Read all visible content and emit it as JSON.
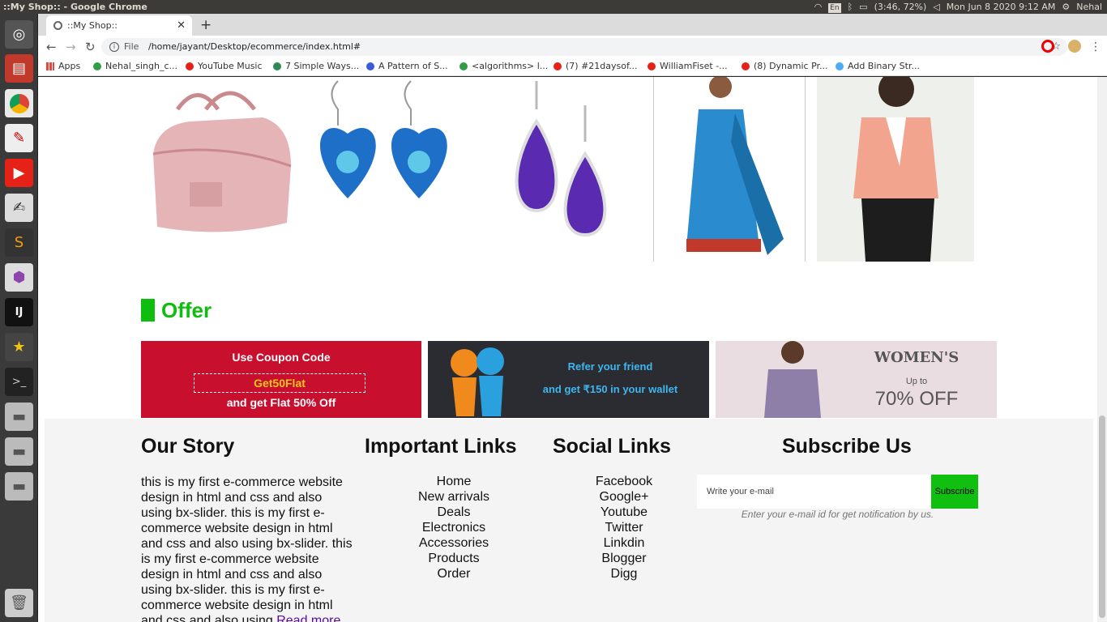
{
  "system": {
    "window_title": "::My Shop:: - Google Chrome",
    "lang": "En",
    "battery": "(3:46, 72%)",
    "datetime": "Mon Jun 8 2020 9:12 AM",
    "user": "Nehal"
  },
  "browser": {
    "tab_title": "::My Shop::",
    "scheme": "File",
    "url": "/home/jayant/Desktop/ecommerce/index.html#",
    "bookmarks": [
      {
        "label": "Apps",
        "color": "#e8453c"
      },
      {
        "label": "Nehal_singh_c...",
        "color": "#2f9e44"
      },
      {
        "label": "YouTube Music",
        "color": "#e62117"
      },
      {
        "label": "7 Simple Ways...",
        "color": "#2e8b57"
      },
      {
        "label": "A Pattern of S...",
        "color": "#3b5bdb"
      },
      {
        "label": "<algorithms> l...",
        "color": "#2f9e44"
      },
      {
        "label": "(7) #21daysof...",
        "color": "#e62117"
      },
      {
        "label": "WilliamFiset -...",
        "color": "#e62117"
      },
      {
        "label": "(8) Dynamic Pr...",
        "color": "#e62117"
      },
      {
        "label": "Add Binary Str...",
        "color": "#4dabf7"
      }
    ]
  },
  "offer": {
    "heading": "Offer",
    "banners": [
      {
        "line1": "Use Coupon Code",
        "code": "Get50Flat",
        "line2": "and get Flat 50% Off"
      },
      {
        "line1": "Refer your friend",
        "line2": "and get ₹150 in your wallet"
      },
      {
        "line1": "WOMEN'S",
        "line2": "Up to",
        "line3": "70% OFF"
      }
    ]
  },
  "footer": {
    "story_title": "Our Story",
    "story_text": "this is my first e-commerce website design in html and css and also using bx-slider. this is my first e-commerce website design in html and css and also using bx-slider. this is my first e-commerce website design in html and css and also using bx-slider. this is my first e-commerce website design in html and css and also using ",
    "read_more": "Read more",
    "important_title": "Important Links",
    "important_links": [
      "Home",
      "New arrivals",
      "Deals",
      "Electronics",
      "Accessories",
      "Products",
      "Order"
    ],
    "social_title": "Social Links",
    "social_links": [
      "Facebook",
      "Google+",
      "Youtube",
      "Twitter",
      "Linkdin",
      "Blogger",
      "Digg"
    ],
    "subscribe_title": "Subscribe Us",
    "email_placeholder": "Write your e-mail",
    "subscribe_button": "Subscribe",
    "subscribe_note": "Enter your e-mail id for get notification by us."
  }
}
